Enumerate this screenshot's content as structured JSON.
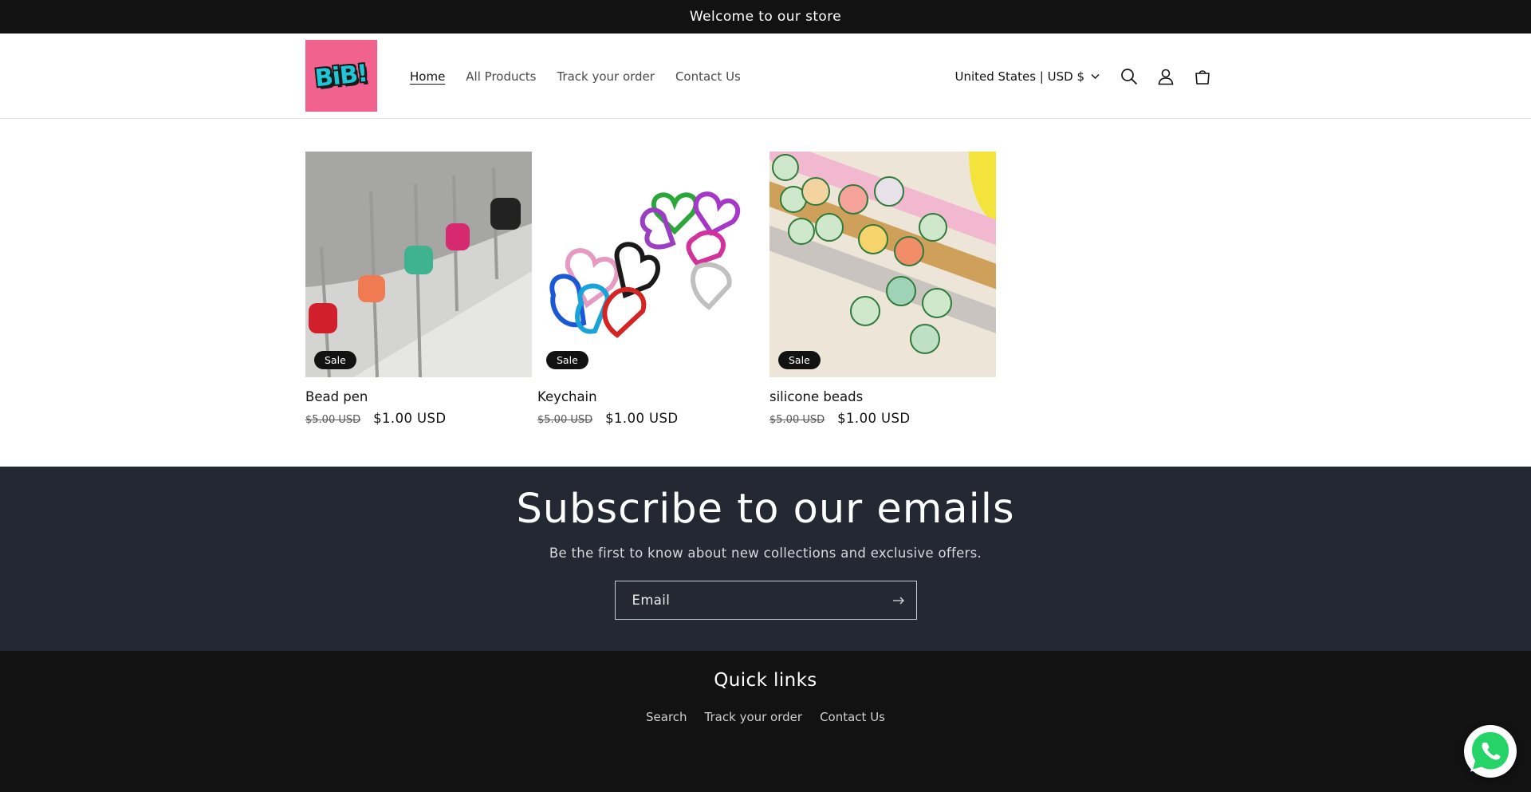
{
  "announcement": {
    "text": "Welcome to our store"
  },
  "header": {
    "logo_text": "BiB!",
    "nav": [
      {
        "label": "Home",
        "active": true
      },
      {
        "label": "All Products",
        "active": false
      },
      {
        "label": "Track your order",
        "active": false
      },
      {
        "label": "Contact Us",
        "active": false
      }
    ],
    "currency": "United States | USD $",
    "icons": [
      "search-icon",
      "account-icon",
      "cart-icon"
    ]
  },
  "products": [
    {
      "title": "Bead pen",
      "badge": "Sale",
      "price_old": "$5.00 USD",
      "price_new": "$1.00 USD"
    },
    {
      "title": "Keychain",
      "badge": "Sale",
      "price_old": "$5.00 USD",
      "price_new": "$1.00 USD"
    },
    {
      "title": "silicone beads",
      "badge": "Sale",
      "price_old": "$5.00 USD",
      "price_new": "$1.00 USD"
    }
  ],
  "newsletter": {
    "title": "Subscribe to our emails",
    "subtitle": "Be the first to know about new collections and exclusive offers.",
    "email_placeholder": "Email"
  },
  "footer": {
    "title": "Quick links",
    "links": [
      "Search",
      "Track your order",
      "Contact Us"
    ]
  },
  "colors": {
    "announcement_bg": "#121212",
    "newsletter_bg": "#242833",
    "footer_bg": "#121212",
    "logo_bg": "#f2628e",
    "whatsapp_green": "#25d366"
  }
}
